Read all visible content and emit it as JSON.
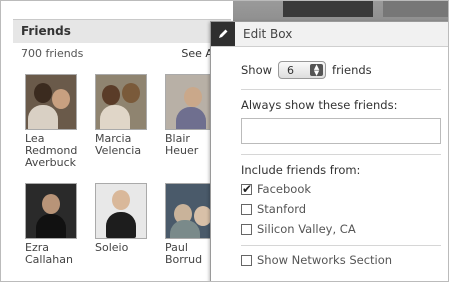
{
  "friends_box": {
    "title": "Friends",
    "count_text": "700 friends",
    "see_all": "See All",
    "friends": [
      {
        "first": "Lea",
        "rest": "Redmond Averbuck"
      },
      {
        "first": "Marcia",
        "rest": "Velencia"
      },
      {
        "first": "Blair",
        "rest": "Heuer"
      },
      {
        "first": "Ezra",
        "rest": "Callahan"
      },
      {
        "first": "Soleio",
        "rest": ""
      },
      {
        "first": "Paul",
        "rest": "Borrud"
      }
    ]
  },
  "edit_box": {
    "title": "Edit Box",
    "show_label": "Show",
    "show_value": "6",
    "show_suffix": "friends",
    "always_show_label": "Always show these friends:",
    "always_show_value": "",
    "include_label": "Include friends from:",
    "sources": [
      {
        "label": "Facebook",
        "checked": true
      },
      {
        "label": "Stanford",
        "checked": false
      },
      {
        "label": "Silicon Valley, CA",
        "checked": false
      }
    ],
    "show_networks_label": "Show Networks Section",
    "show_networks_checked": false
  }
}
